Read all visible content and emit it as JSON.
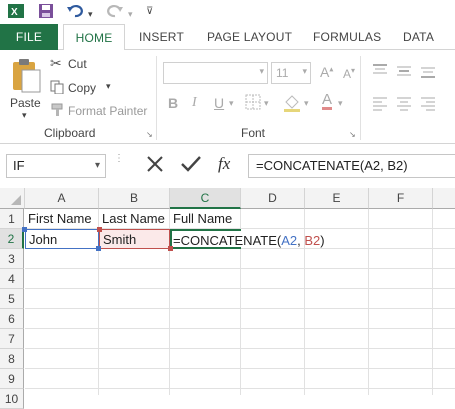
{
  "qat": {
    "save_icon": "save-icon",
    "undo_icon": "undo-icon",
    "redo_icon": "redo-icon"
  },
  "tabs": [
    "FILE",
    "HOME",
    "INSERT",
    "PAGE LAYOUT",
    "FORMULAS",
    "DATA"
  ],
  "ribbon": {
    "paste": "Paste",
    "cut": "Cut",
    "copy": "Copy",
    "format_painter": "Format Painter",
    "clipboard_label": "Clipboard",
    "font_size": "11",
    "font_label": "Font",
    "bold": "B",
    "italic": "I",
    "underline": "U",
    "font_color": "A"
  },
  "formula_bar": {
    "name_box": "IF",
    "fx": "fx",
    "formula": "=CONCATENATE(A2, B2)"
  },
  "grid": {
    "columns": [
      "A",
      "B",
      "C",
      "D",
      "E",
      "F"
    ],
    "rows": [
      "1",
      "2",
      "3",
      "4",
      "5",
      "6",
      "7",
      "8",
      "9",
      "10"
    ],
    "cells": {
      "A1": "First Name",
      "B1": "Last Name",
      "C1": "Full Name",
      "A2": "John",
      "B2": "Smith"
    },
    "edit_cell": {
      "prefix": "=CONCATENATE(",
      "ref1": "A2",
      "sep": ", ",
      "ref2": "B2",
      "suffix": ")"
    }
  },
  "colors": {
    "accent": "#217346",
    "ref_blue": "#4472c4",
    "ref_red": "#c0504d"
  }
}
